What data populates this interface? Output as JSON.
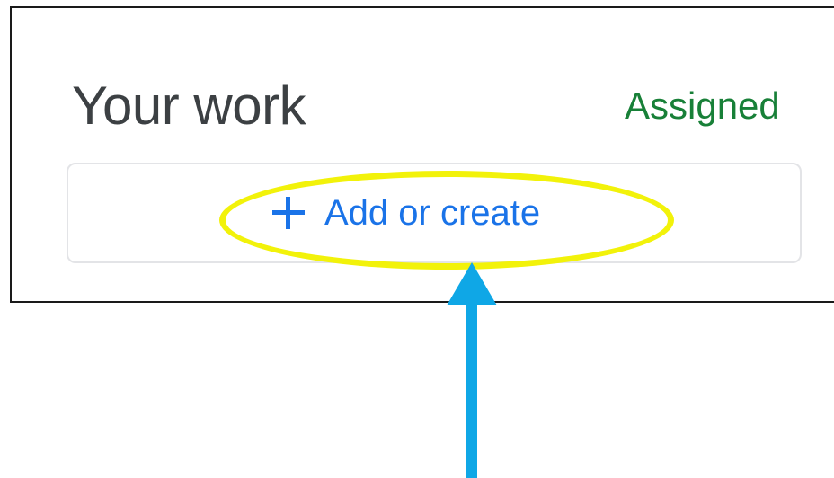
{
  "section": {
    "title": "Your work",
    "status": "Assigned"
  },
  "add_button": {
    "label": "Add or create",
    "icon": "plus-icon"
  },
  "annotation": {
    "highlight_color": "#f2f20a",
    "arrow_color": "#0fa7e6"
  },
  "colors": {
    "title": "#3c4043",
    "status": "#188038",
    "accent": "#1a73e8"
  }
}
